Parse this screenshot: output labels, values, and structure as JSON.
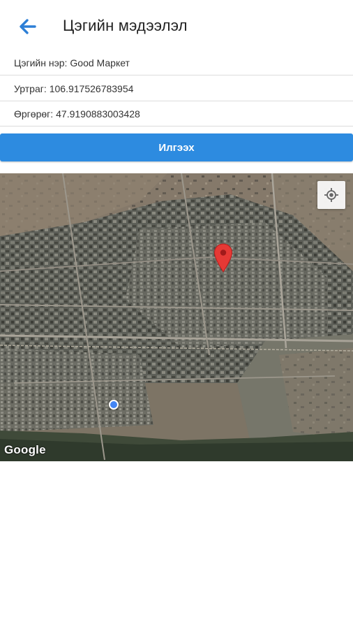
{
  "header": {
    "title": "Цэгийн мэдээлэл",
    "back_icon": "arrow-left-icon",
    "accent": "#2d7fd6"
  },
  "info": {
    "name_label": "Цэгийн нэр:",
    "name_value": "Good Маркет",
    "lng_label": "Уртраг:",
    "lng_value": "106.917526783954",
    "lat_label": "Өргөрөг:",
    "lat_value": "47.9190883003428"
  },
  "actions": {
    "send_label": "Илгээх",
    "send_color": "#2d8be0"
  },
  "map": {
    "type": "satellite",
    "attribution": "Google",
    "marker_icon": "map-pin-icon",
    "marker_color": "#e53935",
    "locate_icon": "my-location-icon",
    "my_location_color": "#4285f4"
  }
}
